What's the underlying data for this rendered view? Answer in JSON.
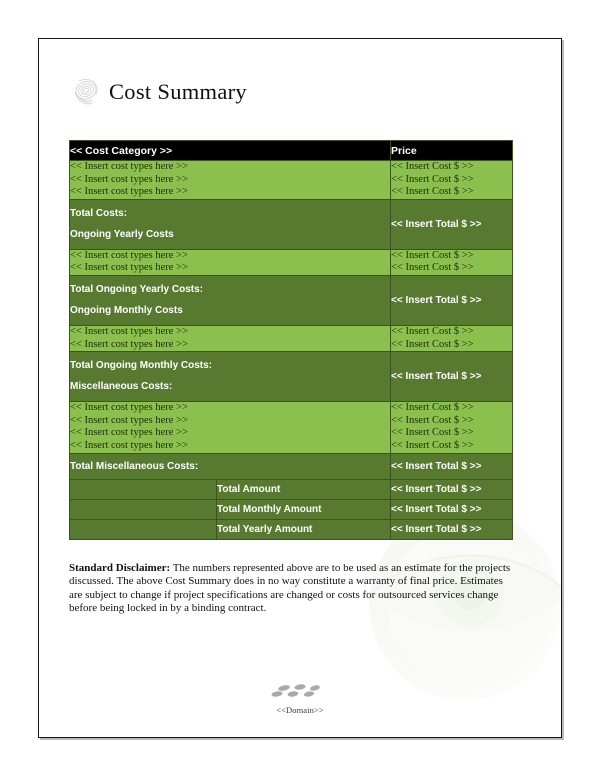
{
  "document": {
    "title": "Cost Summary",
    "title_ornament_icon": "scribble-swirl-ornament-icon",
    "watermark_icon": "eye-watermark-icon"
  },
  "table": {
    "header": {
      "category": "<< Cost Category >>",
      "price": "Price"
    },
    "colors": {
      "header_bg": "#000000",
      "header_text": "#ffffff",
      "row_light_bg": "#8cc04e",
      "row_light_text": "#1b2d08",
      "row_dark_bg": "#577a30",
      "row_dark_text": "#ffffff",
      "border": "#3c5520"
    },
    "placeholders": {
      "cost_type": "<< Insert cost types here >>",
      "cost_value": "<< Insert Cost $ >>",
      "total_value": "<< Insert Total $ >>"
    },
    "sections": [
      {
        "kind": "entries",
        "rows": [
          {
            "category": "<< Insert cost types here >>",
            "price": "<< Insert Cost $ >>"
          },
          {
            "category": "<< Insert cost types here >>",
            "price": "<< Insert Cost $ >>"
          },
          {
            "category": "<< Insert cost types here >>",
            "price": "<< Insert Cost $ >>"
          }
        ]
      },
      {
        "kind": "total_and_heading",
        "total_label": "Total Costs:",
        "total_value": "<< Insert Total $ >>",
        "next_heading": "Ongoing Yearly Costs"
      },
      {
        "kind": "entries",
        "rows": [
          {
            "category": "<< Insert cost types here >>",
            "price": "<< Insert Cost $ >>"
          },
          {
            "category": "<< Insert cost types here >>",
            "price": "<< Insert Cost $ >>"
          }
        ]
      },
      {
        "kind": "total_and_heading",
        "total_label": "Total Ongoing Yearly Costs:",
        "total_value": "<< Insert Total $ >>",
        "next_heading": "Ongoing Monthly Costs"
      },
      {
        "kind": "entries",
        "rows": [
          {
            "category": "<< Insert cost types here >>",
            "price": "<< Insert Cost $ >>"
          },
          {
            "category": "<< Insert cost types here >>",
            "price": "<< Insert Cost $ >>"
          }
        ]
      },
      {
        "kind": "total_and_heading",
        "total_label": "Total Ongoing Monthly Costs:",
        "total_value": "<< Insert Total $ >>",
        "next_heading": "Miscellaneous Costs:"
      },
      {
        "kind": "entries",
        "rows": [
          {
            "category": "<< Insert cost types here >>",
            "price": "<< Insert Cost $ >>"
          },
          {
            "category": "<< Insert cost types here >>",
            "price": "<< Insert Cost $ >>"
          },
          {
            "category": "<< Insert cost types here >>",
            "price": "<< Insert Cost $ >>"
          },
          {
            "category": "<< Insert cost types here >>",
            "price": "<< Insert Cost $ >>"
          }
        ]
      },
      {
        "kind": "total_only",
        "total_label": "Total Miscellaneous Costs:",
        "total_value": "<< Insert Total $ >>"
      }
    ],
    "summary_rows": [
      {
        "blank": "",
        "label": "Total Amount",
        "value": "<< Insert Total $ >>"
      },
      {
        "blank": "",
        "label": "Total Monthly Amount",
        "value": "<< Insert Total $ >>"
      },
      {
        "blank": "",
        "label": "Total Yearly Amount",
        "value": "<< Insert Total $ >>"
      }
    ]
  },
  "disclaimer": {
    "lead": "Standard Disclaimer:",
    "body": " The numbers represented above are to be used as an estimate for the projects discussed. The above Cost Summary does in no way constitute a warranty of final price.  Estimates are subject to change if project specifications are changed or costs for outsourced services change before being locked in by a binding contract."
  },
  "footer": {
    "domain": "<<Domain>>",
    "ornament_icon": "pebble-cluster-ornament-icon"
  }
}
